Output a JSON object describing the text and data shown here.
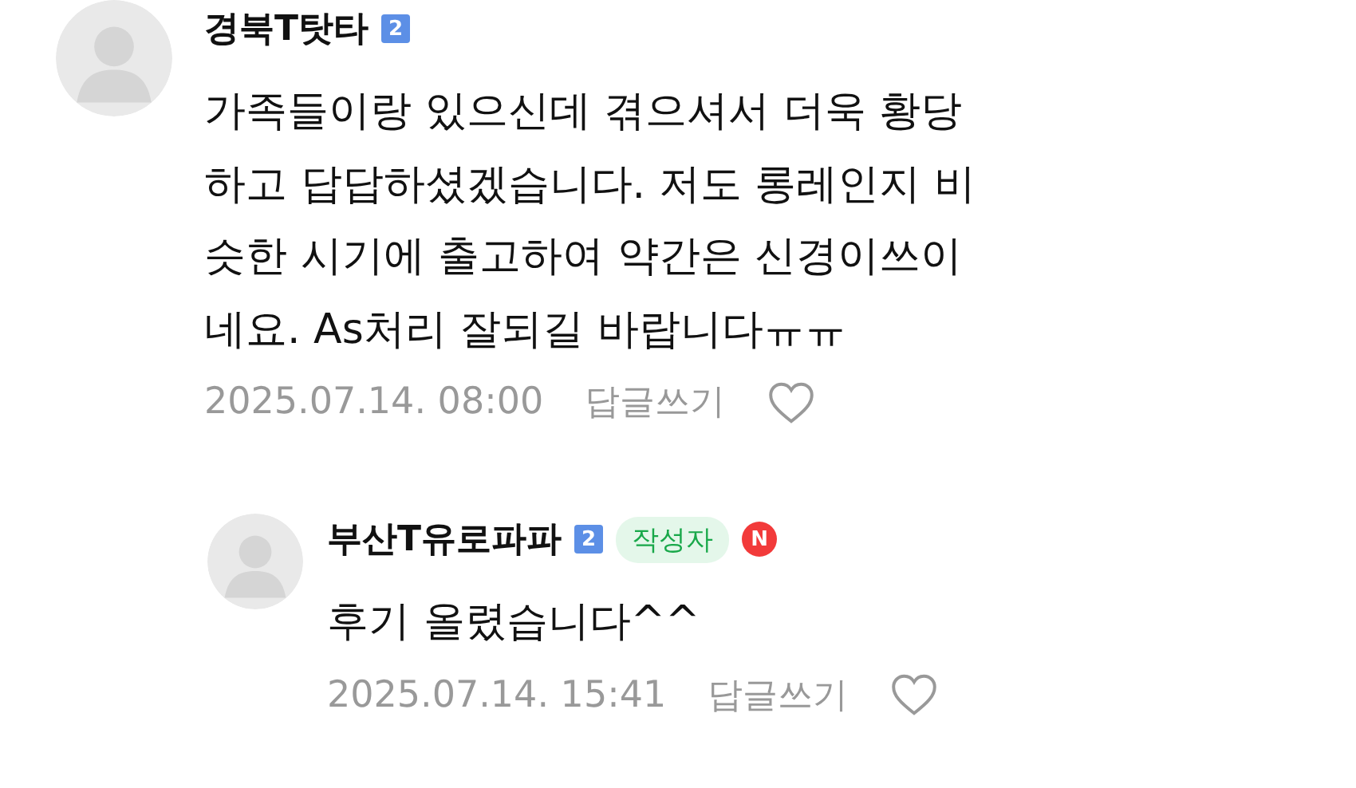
{
  "comments": [
    {
      "author": "경북T탓타",
      "level": "2",
      "text": "가족들이랑 있으신데 겪으셔서 더욱 황당하고 답답하셨겠습니다. 저도 롱레인지 비슷한 시기에 출고하여 약간은 신경이쓰이네요. As처리 잘되길 바랍니다ㅠㅠ",
      "date": "2025.07.14. 08:00",
      "reply": "답글쓰기",
      "liked": false,
      "children": [
        {
          "author": "부산T유로파파",
          "level": "2",
          "author_tag": "작성자",
          "new_badge": "N",
          "text": "후기 올렸습니다^^",
          "date": "2025.07.14. 15:41",
          "reply": "답글쓰기",
          "liked": false
        }
      ]
    }
  ]
}
